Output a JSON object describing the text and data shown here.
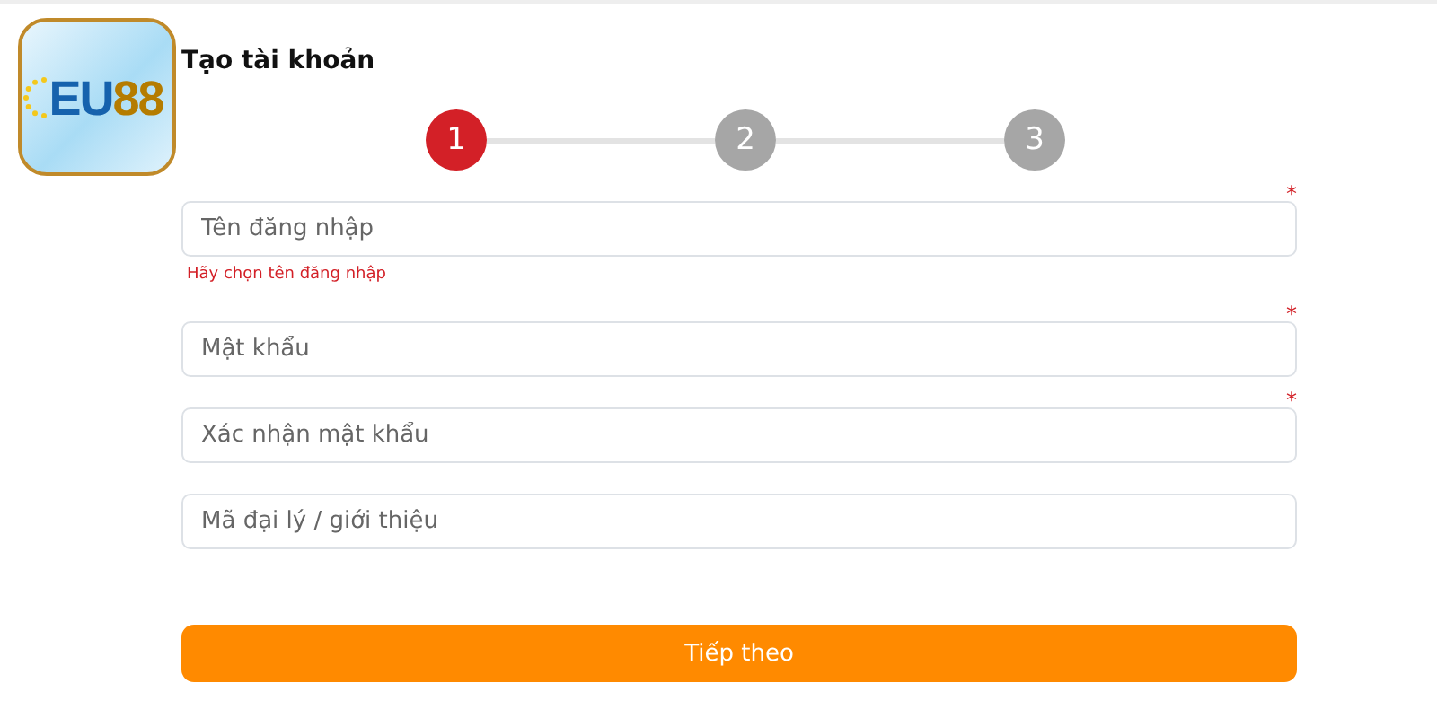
{
  "logo": {
    "text_main": "EU",
    "text_accent": "88"
  },
  "title": "Tạo tài khoản",
  "steps": [
    {
      "label": "1",
      "selected": true
    },
    {
      "label": "2",
      "selected": false
    },
    {
      "label": "3",
      "selected": false
    }
  ],
  "fields": [
    {
      "placeholder": "Tên đăng nhập",
      "asterisk": "*",
      "error": "Hãy chọn tên đăng nhập"
    },
    {
      "placeholder": "Mật khẩu",
      "asterisk": "*"
    },
    {
      "placeholder": "Xác nhận mật khẩu",
      "asterisk": "*"
    },
    {
      "placeholder": "Mã đại lý / giới thiệu"
    }
  ],
  "submit": "Tiếp theo"
}
